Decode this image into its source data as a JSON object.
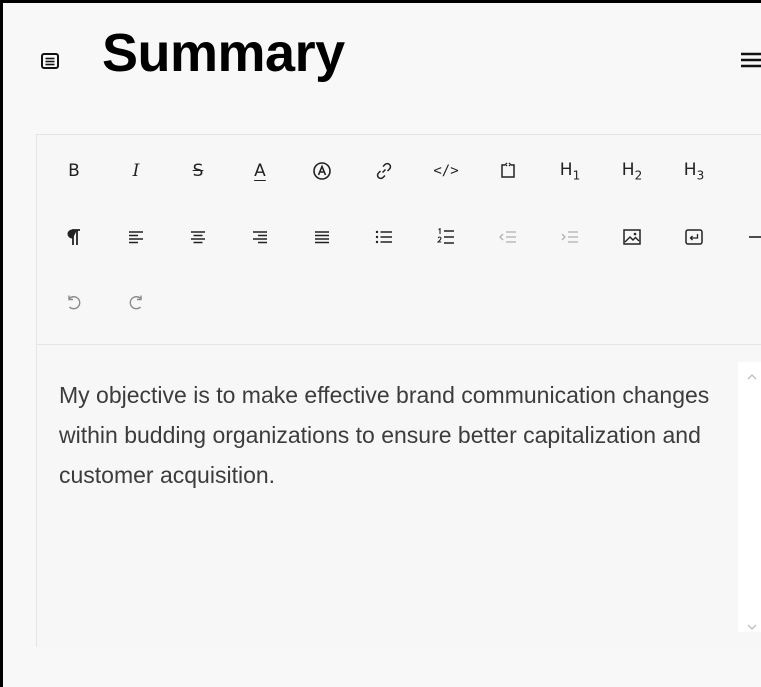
{
  "header": {
    "title": "Summary",
    "doc_icon": "document-lines-icon",
    "menu_icon": "hamburger-menu-icon"
  },
  "toolbar": {
    "row1": [
      {
        "name": "bold-button",
        "icon": "bold-icon",
        "label": "B"
      },
      {
        "name": "italic-button",
        "icon": "italic-icon",
        "label": "I"
      },
      {
        "name": "strikethrough-button",
        "icon": "strikethrough-icon",
        "label": "S"
      },
      {
        "name": "text-color-button",
        "icon": "text-color-icon",
        "label": "A"
      },
      {
        "name": "highlight-button",
        "icon": "highlight-icon",
        "label": "A"
      },
      {
        "name": "link-button",
        "icon": "link-icon"
      },
      {
        "name": "inline-code-button",
        "icon": "code-icon",
        "label": "</>"
      },
      {
        "name": "code-block-button",
        "icon": "code-block-icon"
      },
      {
        "name": "heading-1-button",
        "icon": "h1-icon",
        "label": "H",
        "sub": "1"
      },
      {
        "name": "heading-2-button",
        "icon": "h2-icon",
        "label": "H",
        "sub": "2"
      },
      {
        "name": "heading-3-button",
        "icon": "h3-icon",
        "label": "H",
        "sub": "3"
      }
    ],
    "row2": [
      {
        "name": "paragraph-button",
        "icon": "pilcrow-icon"
      },
      {
        "name": "align-left-button",
        "icon": "align-left-icon"
      },
      {
        "name": "align-center-button",
        "icon": "align-center-icon"
      },
      {
        "name": "align-right-button",
        "icon": "align-right-icon"
      },
      {
        "name": "align-justify-button",
        "icon": "align-justify-icon"
      },
      {
        "name": "bullet-list-button",
        "icon": "bullet-list-icon"
      },
      {
        "name": "ordered-list-button",
        "icon": "ordered-list-icon"
      },
      {
        "name": "outdent-button",
        "icon": "outdent-icon",
        "disabled": true
      },
      {
        "name": "indent-button",
        "icon": "indent-icon",
        "disabled": true
      },
      {
        "name": "image-button",
        "icon": "image-icon"
      },
      {
        "name": "hard-break-button",
        "icon": "hard-break-icon"
      },
      {
        "name": "horizontal-rule-button",
        "icon": "horizontal-rule-icon"
      }
    ],
    "row3": [
      {
        "name": "undo-button",
        "icon": "undo-icon",
        "disabled": true
      },
      {
        "name": "redo-button",
        "icon": "redo-icon",
        "disabled": true
      }
    ]
  },
  "content": {
    "text": "My objective is to make effective brand communication changes within budding organizations to ensure better capitalization and customer acquisition."
  },
  "colors": {
    "page_bg": "#f8f8f8",
    "text": "#3c3c3c",
    "title": "#000000",
    "border": "#e4e4e4"
  }
}
